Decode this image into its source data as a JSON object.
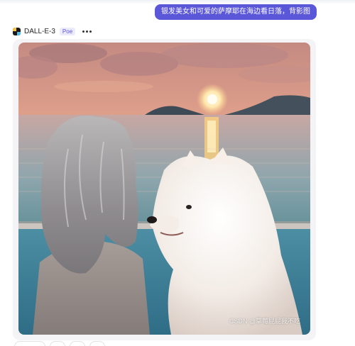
{
  "conversation": {
    "user_message": "银发美女和可爱的萨摩耶在海边看日落，背影图"
  },
  "bot": {
    "name": "DALL-E-3",
    "badge": "Poe",
    "avatar_icon": "dalle-logo-icon",
    "menu_icon": "more-dots-icon"
  },
  "image": {
    "description_icon": "generated-image",
    "watermark": "CSDN @草莓屁屁我不吃"
  },
  "colors": {
    "user_bubble": "#5b57d9",
    "badge_text": "#5b57d9",
    "badge_bg": "#eceafd"
  }
}
